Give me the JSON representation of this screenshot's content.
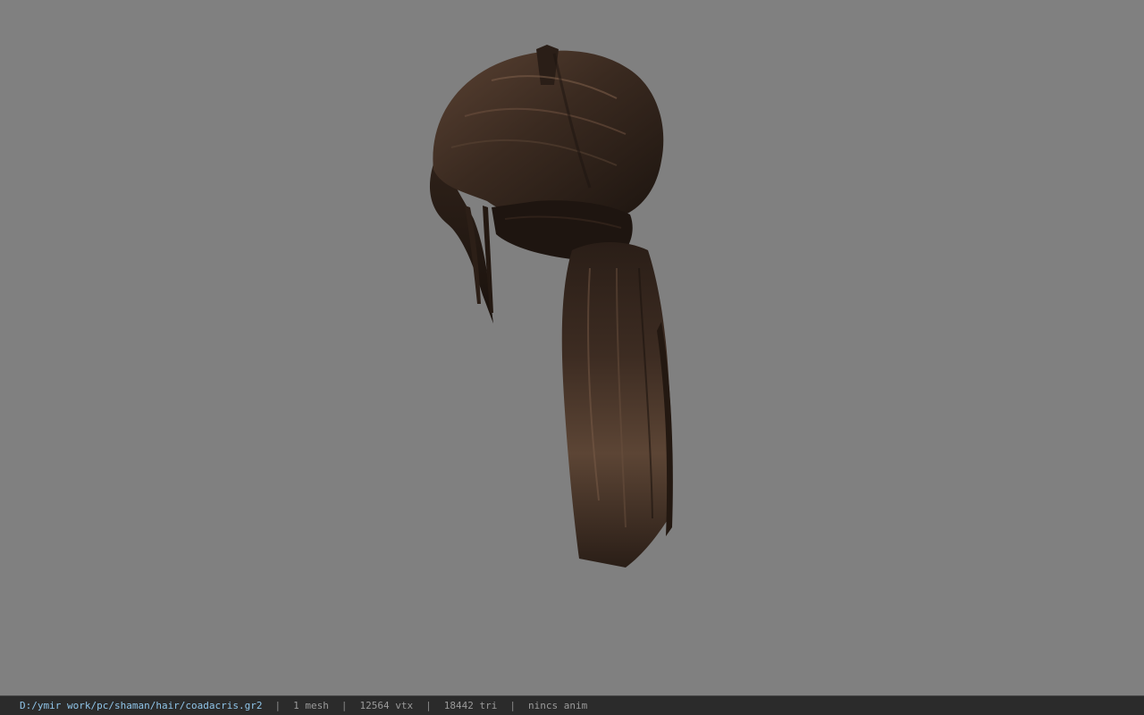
{
  "viewport": {
    "background_color": "#808080",
    "model": {
      "subject": "hair-model",
      "hair_color_dark": "#1c140f",
      "hair_color_mid": "#3a2a20",
      "hair_color_light": "#6a4f3e"
    }
  },
  "status_bar": {
    "file_path": "D:/ymir work/pc/shaman/hair/coadacris.gr2",
    "separator": "|",
    "mesh_count": "1 mesh",
    "vertex_count": "12564 vtx",
    "triangle_count": "18442 tri",
    "animation": "nincs anim",
    "colors": {
      "background": "#2b2b2b",
      "path_text": "#8fc4e8",
      "info_text": "#9a9a9a"
    }
  }
}
